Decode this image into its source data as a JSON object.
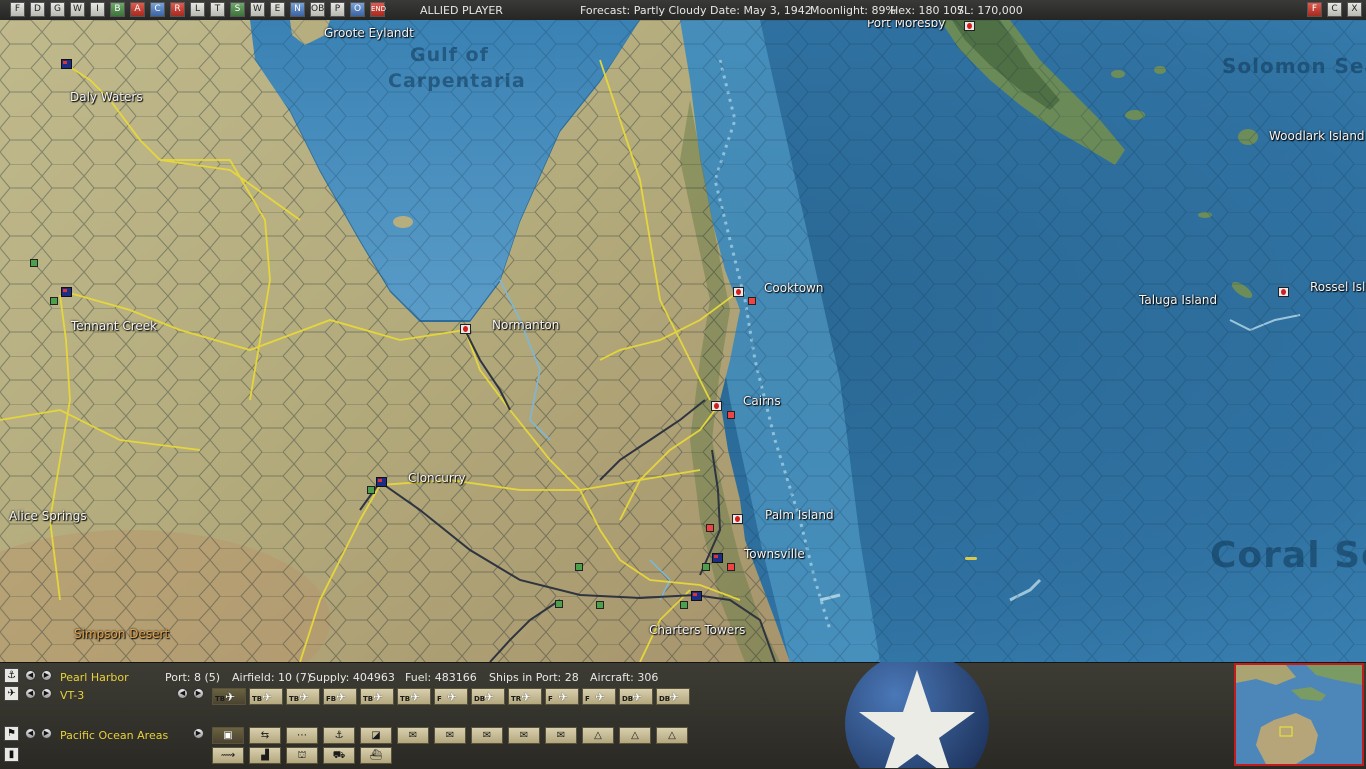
{
  "topbar": {
    "player": "ALLIED PLAYER",
    "forecast": "Forecast: Partly Cloudy",
    "date": "Date: May 3, 1942",
    "moonlight": "Moonlight: 89%",
    "hex": "Hex: 180 107",
    "sl": "SL: 170,000",
    "left_buttons": [
      "F",
      "D",
      "G",
      "W",
      "I",
      "B",
      "A",
      "C",
      "R",
      "L",
      "T",
      "S",
      "W",
      "E",
      "N",
      "OB",
      "P",
      "O",
      "END"
    ],
    "right_buttons": [
      "F",
      "C",
      "X"
    ]
  },
  "map": {
    "places": {
      "groote": "Groote Eylandt",
      "daly": "Daly Waters",
      "tennant": "Tennant Creek",
      "alice": "Alice Springs",
      "simpson": "Simpson Desert",
      "normanton": "Normanton",
      "cloncurry": "Cloncurry",
      "cooktown": "Cooktown",
      "cairns": "Cairns",
      "palm": "Palm Island",
      "townsville": "Townsville",
      "charters": "Charters Towers",
      "moresby": "Port Moresby",
      "woodlark": "Woodlark Island",
      "taluga": "Taluga Island",
      "rossel": "Rossel Isl"
    },
    "seas": {
      "gulf1": "Gulf of",
      "gulf2": "Carpentaria",
      "solomon": "Solomon Sea",
      "coral": "Coral Sea"
    },
    "colors": {
      "ocean": "#2f6f9e",
      "land": "#b8b084",
      "roads": "#e8d83a",
      "rail": "#2e3440"
    }
  },
  "panel": {
    "hq_name": "Pearl Harbor",
    "port": "Port: 8 (5)",
    "airfield": "Airfield: 10 (7)",
    "supply": "Supply: 404963",
    "fuel": "Fuel: 483166",
    "ships": "Ships in Port: 28",
    "aircraft": "Aircraft: 306",
    "squadron": "VT-3",
    "command": "Pacific Ocean Areas",
    "aircraft_types": [
      "TB",
      "TB",
      "TB",
      "FB",
      "TB",
      "TB",
      "F",
      "DB",
      "TR",
      "F",
      "F",
      "DB",
      "DB"
    ]
  }
}
